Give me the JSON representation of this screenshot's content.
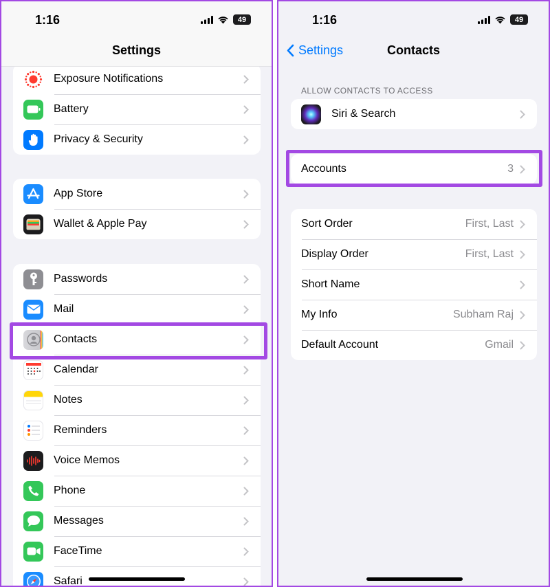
{
  "left": {
    "status": {
      "time": "1:16",
      "battery": "49"
    },
    "title": "Settings",
    "groups": [
      {
        "items": [
          {
            "label": "Exposure Notifications",
            "icon": "exposure-notifications-icon"
          },
          {
            "label": "Battery",
            "icon": "battery-icon",
            "color": "#34c759"
          },
          {
            "label": "Privacy & Security",
            "icon": "hand-icon",
            "color": "#007aff"
          }
        ]
      },
      {
        "items": [
          {
            "label": "App Store",
            "icon": "app-store-icon",
            "color": "#1a8cff"
          },
          {
            "label": "Wallet & Apple Pay",
            "icon": "wallet-icon",
            "color": "#1c1c1e"
          }
        ]
      },
      {
        "items": [
          {
            "label": "Passwords",
            "icon": "key-icon",
            "color": "#8e8e93"
          },
          {
            "label": "Mail",
            "icon": "mail-icon",
            "color": "#1a8cff"
          },
          {
            "label": "Contacts",
            "icon": "contacts-icon",
            "color": "#c7c7cc"
          },
          {
            "label": "Calendar",
            "icon": "calendar-icon",
            "color": "#ffffff"
          },
          {
            "label": "Notes",
            "icon": "notes-icon",
            "color": "#ffd60a"
          },
          {
            "label": "Reminders",
            "icon": "reminders-icon",
            "color": "#ffffff"
          },
          {
            "label": "Voice Memos",
            "icon": "voice-memos-icon",
            "color": "#1c1c1e"
          },
          {
            "label": "Phone",
            "icon": "phone-icon",
            "color": "#34c759"
          },
          {
            "label": "Messages",
            "icon": "messages-icon",
            "color": "#34c759"
          },
          {
            "label": "FaceTime",
            "icon": "facetime-icon",
            "color": "#34c759"
          },
          {
            "label": "Safari",
            "icon": "safari-icon",
            "color": "#1a8cff"
          }
        ]
      }
    ]
  },
  "right": {
    "status": {
      "time": "1:16",
      "battery": "49"
    },
    "back_label": "Settings",
    "title": "Contacts",
    "section_header": "ALLOW CONTACTS TO ACCESS",
    "siri": {
      "label": "Siri & Search",
      "icon": "siri-icon"
    },
    "accounts": {
      "label": "Accounts",
      "detail": "3"
    },
    "prefs": [
      {
        "label": "Sort Order",
        "detail": "First, Last"
      },
      {
        "label": "Display Order",
        "detail": "First, Last"
      },
      {
        "label": "Short Name",
        "detail": ""
      },
      {
        "label": "My Info",
        "detail": "Subham Raj"
      },
      {
        "label": "Default Account",
        "detail": "Gmail"
      }
    ]
  },
  "colors": {
    "highlight": "#a349e3",
    "link": "#007aff",
    "background": "#f2f2f7"
  }
}
